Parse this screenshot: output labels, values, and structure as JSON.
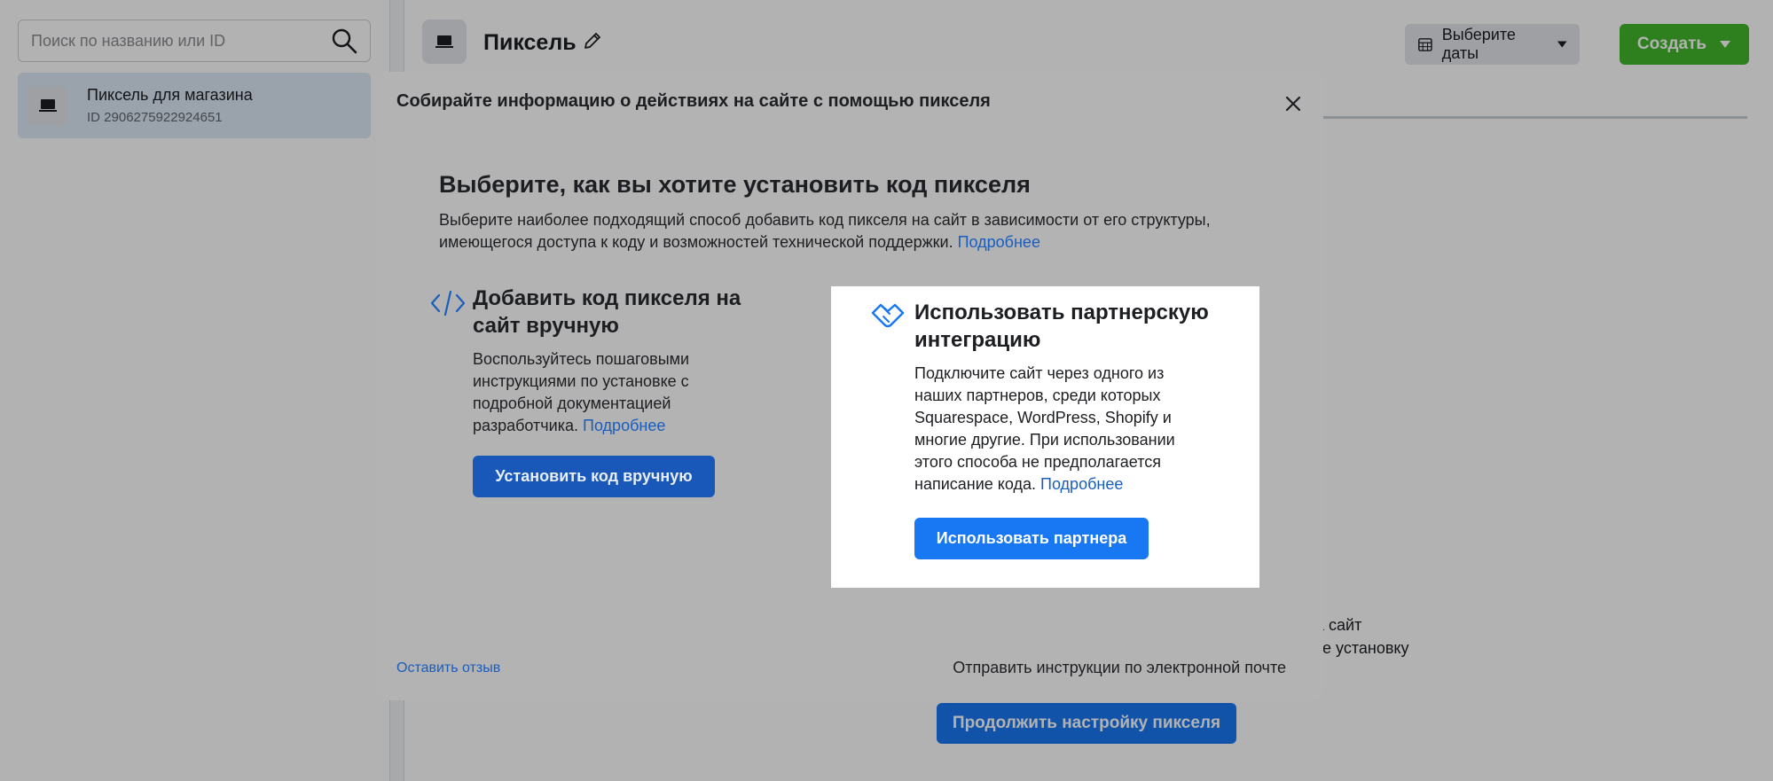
{
  "sidebar": {
    "search_placeholder": "Поиск по названию или ID",
    "pixel_item": {
      "name": "Пиксель для магазина",
      "id": "ID 2906275922924651"
    }
  },
  "header": {
    "title": "Пиксель",
    "date_button": "Выберите даты",
    "create_button": "Создать"
  },
  "background": {
    "text_line_1": "а сайт",
    "text_line_2": "те установку",
    "continue_button": "Продолжить настройку пикселя"
  },
  "modal": {
    "title": "Собирайте информацию о действиях на сайте с помощью пикселя",
    "section_title": "Выберите, как вы хотите установить код пикселя",
    "section_desc_line1": "Выберите наиболее подходящий способ добавить код пикселя на сайт в зависимости от его структуры,",
    "section_desc_line2": "имеющегося доступа к коду и возможностей технической поддержки.",
    "learn_more": "Подробнее",
    "manual": {
      "title_line1": "Добавить код пикселя на",
      "title_line2": "сайт вручную",
      "desc_line1": "Воспользуйтесь пошаговыми",
      "desc_line2": "инструкциями по установке с",
      "desc_line3": "подробной документацией",
      "desc_line4": "разработчика.",
      "link": "Подробнее",
      "button": "Установить код вручную"
    },
    "partner": {
      "title_line1": "Использовать партнерскую",
      "title_line2": "интеграцию",
      "desc_line1": "Подключите сайт через одного из",
      "desc_line2": "наших партнеров, среди которых",
      "desc_line3": "Squarespace, WordPress, Shopify и",
      "desc_line4": "многие другие. При использовании",
      "desc_line5": "этого способа не предполагается",
      "desc_line6": "написание кода.",
      "link": "Подробнее",
      "button": "Использовать партнера"
    },
    "feedback": "Оставить отзыв",
    "email_instructions": "Отправить инструкции по электронной почте"
  },
  "colors": {
    "accent": "#1877f2",
    "create": "#42b72a",
    "overlay": "rgba(0,0,0,0.30)"
  },
  "icons": [
    "search-icon",
    "laptop-icon",
    "pencil-icon",
    "calendar-icon",
    "caret-down-icon",
    "close-icon",
    "code-icon",
    "handshake-icon"
  ]
}
